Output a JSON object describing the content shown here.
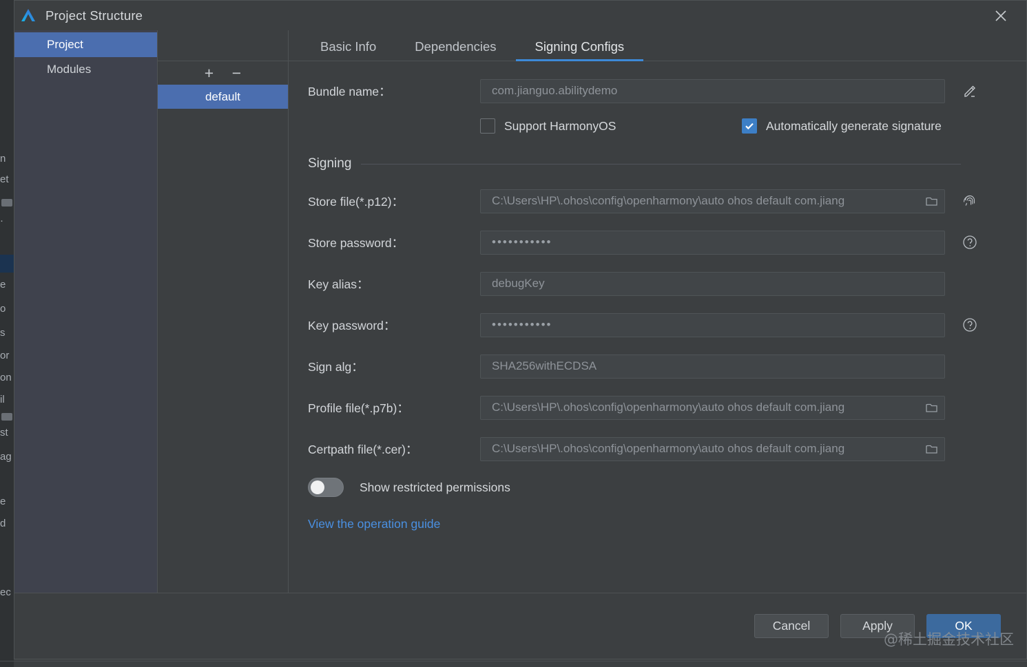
{
  "window": {
    "title": "Project Structure",
    "logo_icon": "deveco-logo-icon",
    "close_icon": "close-icon"
  },
  "sidebar": {
    "items": [
      {
        "label": "Project",
        "selected": true
      },
      {
        "label": "Modules",
        "selected": false
      }
    ]
  },
  "config_list": {
    "add_label": "+",
    "remove_label": "−",
    "items": [
      {
        "label": "default",
        "selected": true
      }
    ]
  },
  "tabs": [
    {
      "label": "Basic Info",
      "active": false
    },
    {
      "label": "Dependencies",
      "active": false
    },
    {
      "label": "Signing Configs",
      "active": true
    }
  ],
  "form": {
    "bundle_name": {
      "label": "Bundle name：",
      "value": "com.jianguo.abilitydemo",
      "edit_icon": "pencil-edit-icon"
    },
    "checkboxes": [
      {
        "label": "Support HarmonyOS",
        "checked": false
      },
      {
        "label": "Automatically generate signature",
        "checked": true
      }
    ],
    "group_title": "Signing",
    "fields": [
      {
        "label": "Store file(*.p12)：",
        "value": "C:\\Users\\HP\\.ohos\\config\\openharmony\\auto ohos default com.jiang",
        "type": "path",
        "folder_icon": "folder-icon",
        "side_icon": "fingerprint-icon"
      },
      {
        "label": "Store password：",
        "value": "•••••••••••",
        "type": "password",
        "side_icon": "help-circle-icon"
      },
      {
        "label": "Key alias：",
        "value": "debugKey",
        "type": "text",
        "side_icon": ""
      },
      {
        "label": "Key password：",
        "value": "•••••••••••",
        "type": "password",
        "side_icon": "help-circle-icon"
      },
      {
        "label": "Sign alg：",
        "value": "SHA256withECDSA",
        "type": "text",
        "side_icon": ""
      },
      {
        "label": "Profile file(*.p7b)：",
        "value": "C:\\Users\\HP\\.ohos\\config\\openharmony\\auto ohos default com.jiang",
        "type": "path",
        "folder_icon": "folder-icon",
        "side_icon": ""
      },
      {
        "label": "Certpath file(*.cer)：",
        "value": "C:\\Users\\HP\\.ohos\\config\\openharmony\\auto ohos default com.jiang",
        "type": "path",
        "folder_icon": "folder-icon",
        "side_icon": ""
      }
    ],
    "toggle": {
      "label": "Show restricted permissions",
      "on": false
    },
    "guide_link": "View the operation guide"
  },
  "footer": {
    "cancel_label": "Cancel",
    "apply_label": "Apply",
    "ok_label": "OK",
    "watermark": "@稀土掘金技术社区"
  },
  "background": {
    "fragments": [
      "n",
      "et",
      "·",
      "e",
      "o",
      "s",
      "or",
      "on",
      "il",
      "st",
      "ag",
      "e",
      "d",
      "ec"
    ]
  },
  "colors": {
    "accent_blue": "#4b6eaf",
    "tab_underline": "#3d8ad8",
    "link_blue": "#4a90e2",
    "checkbox_blue": "#3d7fc6",
    "primary_button": "#3c6a9e",
    "panel_bg": "#3c3f41",
    "nav_bg": "#3f424d"
  }
}
